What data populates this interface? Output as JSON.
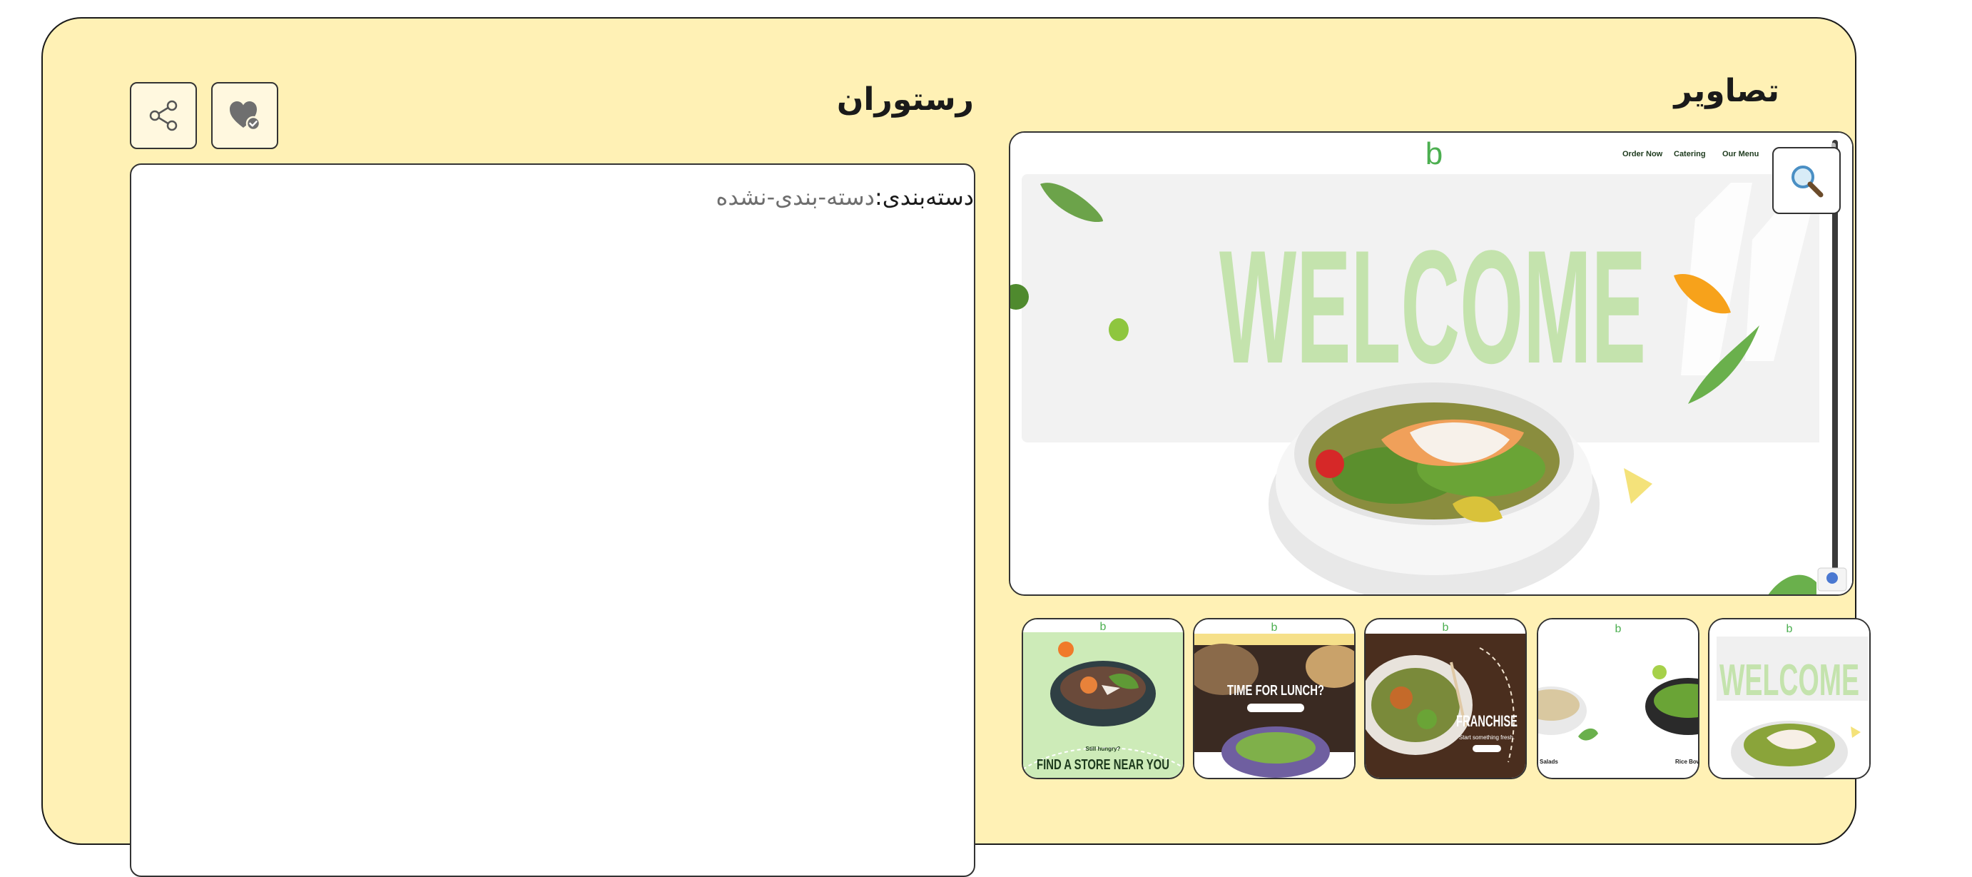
{
  "images": {
    "title": "تصاویر",
    "main": {
      "nav": [
        "Order Now",
        "Catering",
        "Our Menu"
      ],
      "logo": "b",
      "hero_text": "WELCOME"
    },
    "thumbnails": [
      {
        "logo": "b",
        "text": "WELCOME"
      },
      {
        "logo": "b",
        "left_label": "Salads",
        "right_label": "Rice Bow"
      },
      {
        "logo": "b",
        "text": "FRANCHISE",
        "sub": "Start something fresh."
      },
      {
        "logo": "b",
        "text": "TIME FOR LUNCH?"
      },
      {
        "logo": "b",
        "small": "Still hungry?",
        "text": "FIND A STORE NEAR YOU"
      }
    ]
  },
  "restaurant": {
    "title": "رستوران",
    "category_label": "دسته‌بندی:",
    "category_value": "دسته-بندی-نشده"
  },
  "icons": {
    "share": "share-icon",
    "favorite": "heart-check-icon",
    "zoom": "magnifier-icon"
  },
  "colors": {
    "card_bg": "#fff1b5",
    "welcome_green": "#c4e3ad",
    "brand_green": "#4caf50"
  }
}
